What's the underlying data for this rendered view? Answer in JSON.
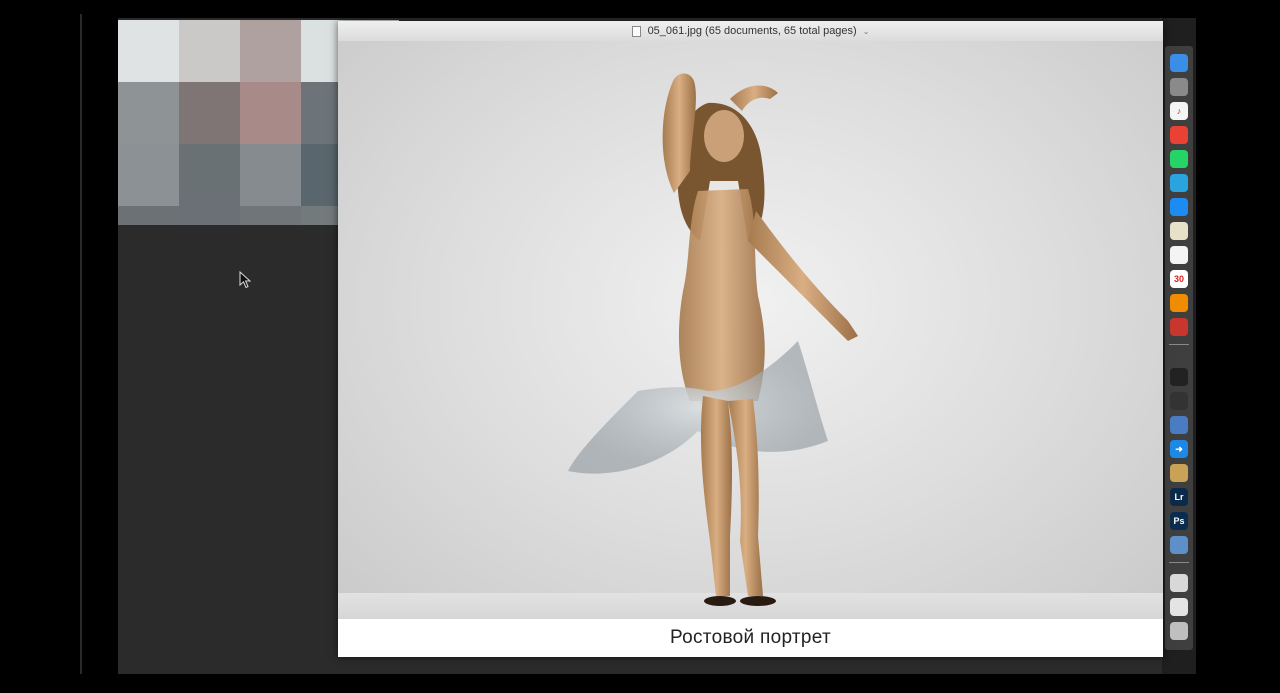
{
  "quicklook": {
    "title": "05_061.jpg (65 documents, 65 total pages)",
    "caption": "Ростовой портрет"
  },
  "dock": {
    "items": [
      {
        "name": "finder-icon",
        "label": "",
        "color": "#3a8ee6"
      },
      {
        "name": "system-preferences-icon",
        "label": "",
        "color": "#8a8a8a"
      },
      {
        "name": "itunes-icon",
        "label": "♪",
        "color": "#f5f5f5"
      },
      {
        "name": "chrome-icon",
        "label": "",
        "color": "#e94235"
      },
      {
        "name": "whatsapp-icon",
        "label": "",
        "color": "#25d366"
      },
      {
        "name": "telegram-icon",
        "label": "",
        "color": "#2aa3df"
      },
      {
        "name": "messenger-icon",
        "label": "",
        "color": "#1c8cf3"
      },
      {
        "name": "notes-icon",
        "label": "",
        "color": "#e7e1c9"
      },
      {
        "name": "textedit-icon",
        "label": "",
        "color": "#f4f4f4"
      },
      {
        "name": "calendar-icon",
        "label": "30",
        "color": "#ffffff"
      },
      {
        "name": "vlc-icon",
        "label": "",
        "color": "#f08c00"
      },
      {
        "name": "photo-booth-icon",
        "label": "",
        "color": "#c8362e"
      },
      {
        "name": "github-icon",
        "label": "",
        "color": "#222222"
      },
      {
        "name": "camera-app-icon",
        "label": "",
        "color": "#333333"
      },
      {
        "name": "screen-capture-icon",
        "label": "",
        "color": "#4a7cc2"
      },
      {
        "name": "migration-arrow-icon",
        "label": "➜",
        "color": "#1e88e5"
      },
      {
        "name": "photo-app-icon",
        "label": "",
        "color": "#c9a257"
      },
      {
        "name": "lightroom-icon",
        "label": "Lr",
        "color": "#0b2a4a"
      },
      {
        "name": "photoshop-icon",
        "label": "Ps",
        "color": "#0a2c4f"
      },
      {
        "name": "preview-icon",
        "label": "",
        "color": "#5f8fc9"
      },
      {
        "name": "downloads-folder-icon",
        "label": "",
        "color": "#d8d8d8"
      },
      {
        "name": "documents-folder-icon",
        "label": "",
        "color": "#e4e4e4"
      },
      {
        "name": "trash-icon",
        "label": "",
        "color": "#bfbfbf"
      }
    ]
  },
  "pixelated": {
    "colors": [
      "#dfe3e4",
      "#cbc8c8",
      "#aea1a0",
      "#dbe0e1",
      "#d9dddf",
      "#8e9496",
      "#7f7575",
      "#a88b88",
      "#6c7479",
      "#c7cbcd",
      "#8b9194",
      "#6a7175",
      "#858b8e",
      "#5a666d",
      "#b4b9bb",
      "#6b7175",
      "#6a7075",
      "#6f7579",
      "#727a7c",
      "#a5aaad"
    ]
  }
}
